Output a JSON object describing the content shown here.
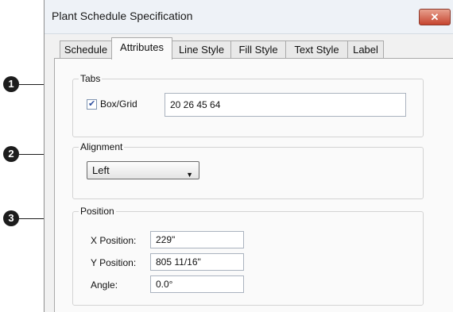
{
  "window": {
    "title": "Plant Schedule Specification",
    "close_glyph": "✕"
  },
  "tabs": [
    {
      "label": "Schedule"
    },
    {
      "label": "Attributes"
    },
    {
      "label": "Line Style"
    },
    {
      "label": "Fill Style"
    },
    {
      "label": "Text Style"
    },
    {
      "label": "Label"
    }
  ],
  "groups": {
    "tabs": {
      "legend": "Tabs",
      "checkbox_label": "Box/Grid",
      "checked": true,
      "value": "20 26 45 64"
    },
    "alignment": {
      "legend": "Alignment",
      "selected": "Left"
    },
    "position": {
      "legend": "Position",
      "x_label": "X Position:",
      "x_value": "229\"",
      "y_label": "Y Position:",
      "y_value": "805 11/16\"",
      "angle_label": "Angle:",
      "angle_value": "0.0°"
    }
  },
  "callouts": [
    "1",
    "2",
    "3"
  ],
  "icons": {
    "close": "close-icon",
    "dropdown": "chevron-down-icon",
    "check": "checkmark-icon"
  }
}
